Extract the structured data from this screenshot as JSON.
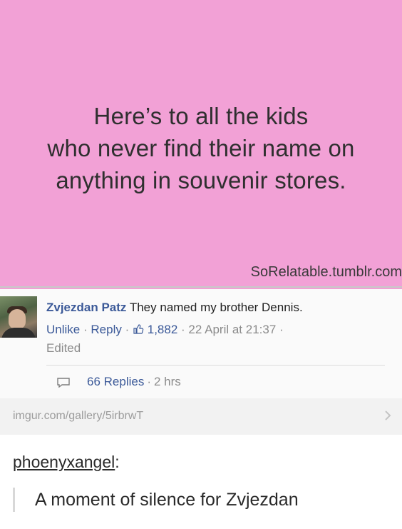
{
  "image_post": {
    "headline_lines": [
      "Here’s to all the kids",
      "who never find their name on",
      "anything in souvenir stores."
    ],
    "watermark": "SoRelatable.tumblr.com"
  },
  "facebook_comment": {
    "author": "Zvjezdan Patz",
    "text": "They named my brother Dennis.",
    "unlike_label": "Unlike",
    "reply_label": "Reply",
    "like_count": "1,882",
    "timestamp": "22 April at 21:37",
    "dot": "·",
    "edited_label": "Edited",
    "replies_count": "66 Replies",
    "replies_time": "2 hrs"
  },
  "source": {
    "url": "imgur.com/gallery/5irbrwT",
    "arrow_icon": "chevron-right-icon"
  },
  "reblog": {
    "username": "phoenyxangel",
    "colon": ":",
    "quote": "A moment of silence for Zvjezdan"
  }
}
